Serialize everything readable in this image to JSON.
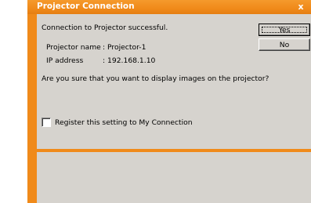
{
  "window": {
    "title": "Projector Connection",
    "close_glyph": "x",
    "accent_color": "#f08a1a",
    "background_color": "#d6d3ce"
  },
  "dialog": {
    "message": "Connection to Projector successful.",
    "projector_name_label": "Projector name",
    "projector_name_value": ":  Projector-1",
    "ip_address_label": "IP address",
    "ip_address_value": ":  192.168.1.10",
    "question": "Are you sure that you want to display images on the projector?",
    "register_checkbox_label": "Register this setting to My Connection",
    "register_checked": false
  },
  "buttons": {
    "yes_label": "Yes",
    "no_label": "No"
  }
}
